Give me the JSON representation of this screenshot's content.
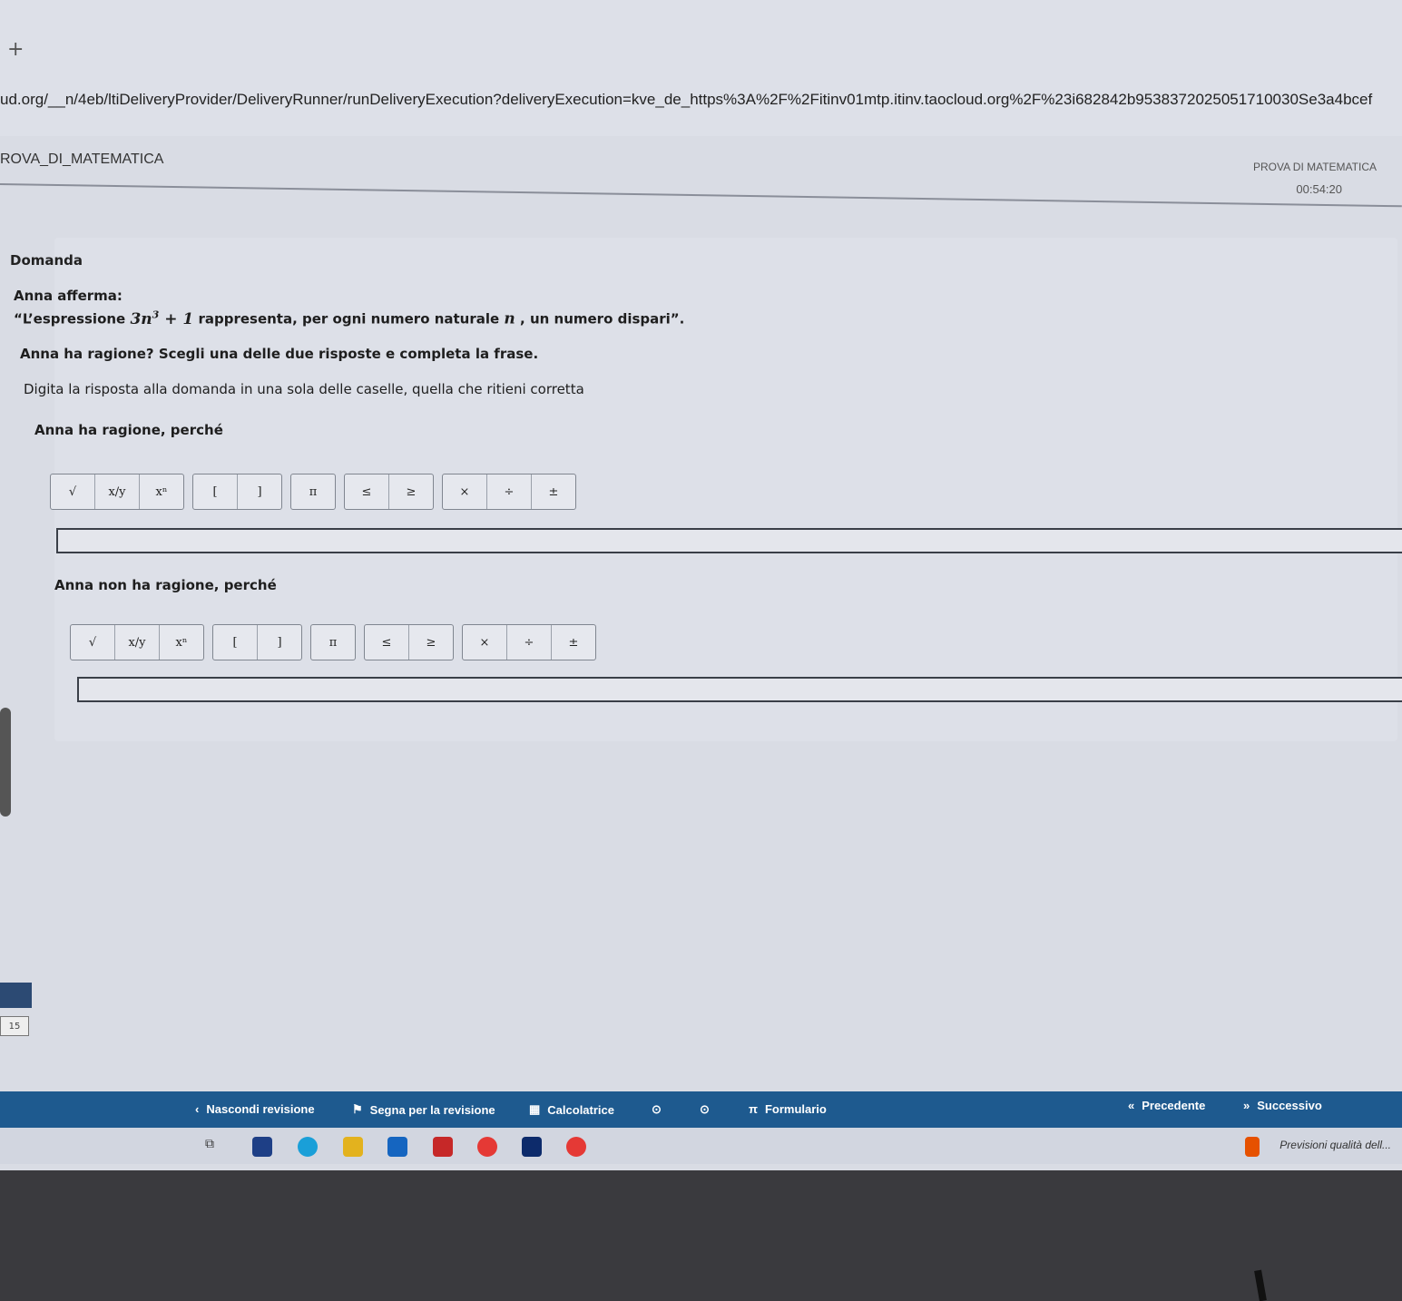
{
  "browser": {
    "new_tab": "+",
    "url": "ud.org/__n/4eb/ltiDeliveryProvider/DeliveryRunner/runDeliveryExecution?deliveryExecution=kve_de_https%3A%2F%2Fitinv01mtp.itinv.taocloud.org%2F%23i682842b9538372025051710030Se3a4bcef"
  },
  "header": {
    "test_title": "ROVA_DI_MATEMATICA",
    "right_title": "PROVA DI MATEMATICA",
    "timer": "00:54:20"
  },
  "question": {
    "label": "Domanda",
    "line1": "Anna afferma:",
    "line2_prefix": "“L’espressione ",
    "expr_base": "3n",
    "expr_exp": "3",
    "expr_tail": " + 1",
    "line2_mid": " rappresenta, per ogni numero naturale ",
    "var_n": "n",
    "line2_suffix": " , un numero dispari”.",
    "line3": "Anna ha ragione? Scegli una delle due risposte e completa la frase.",
    "line4": "Digita la risposta alla domanda in una sola delle caselle, quella che ritieni corretta"
  },
  "option_yes": {
    "label": "Anna ha ragione, perché"
  },
  "option_no": {
    "label": "Anna non ha ragione, perché"
  },
  "keys": {
    "sqrt": "√",
    "frac": "x/y",
    "pow": "xⁿ",
    "lbr": "[",
    "rbr": "]",
    "pi": "π",
    "le": "≤",
    "ge": "≥",
    "times": "×",
    "div": "÷",
    "pm": "±"
  },
  "sidebar": {
    "page": "15"
  },
  "navbar": {
    "hide_review": "Nascondi revisione",
    "mark_review": "Segna per la revisione",
    "calculator": "Calcolatrice",
    "formulary": "Formulario",
    "previous": "Precedente",
    "next": "Successivo"
  },
  "taskbar": {
    "news": "Previsioni qualità dell..."
  },
  "colors": {
    "accent": "#1e5a8f",
    "page_bg": "#d9dce4"
  }
}
